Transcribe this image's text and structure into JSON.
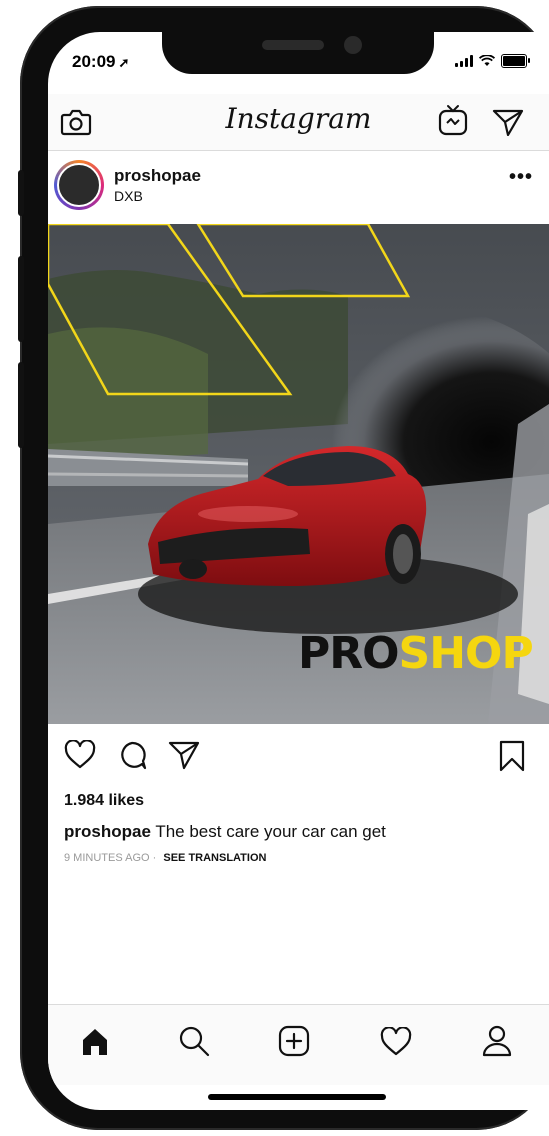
{
  "status": {
    "time": "20:09",
    "location_arrow": "➚"
  },
  "header": {
    "logo": "Instagram",
    "left_icon": "camera-icon",
    "right_icons": [
      "igtv-icon",
      "direct-icon"
    ]
  },
  "post": {
    "username": "proshopae",
    "location": "DXB",
    "more": "•••",
    "image": {
      "description_icon": "post-photo",
      "brand_pro": "PRO",
      "brand_shop": "SHOP",
      "accent": "#f5d60f",
      "car_color": "#b3181c"
    },
    "likes": "1.984 likes",
    "caption_user": "proshopae",
    "caption_text": "The best care your car can get",
    "time_ago": "9 MINUTES AGO",
    "separator": "·",
    "see_translation": "SEE TRANSLATION"
  },
  "actions": [
    "like-icon",
    "comment-icon",
    "share-icon",
    "save-icon"
  ],
  "bottom_nav": [
    "home-icon",
    "search-icon",
    "new-post-icon",
    "activity-icon",
    "profile-icon"
  ],
  "colors": {
    "border": "#dbdbdb",
    "meta_gray": "#9a9a9a",
    "text": "#111111"
  }
}
